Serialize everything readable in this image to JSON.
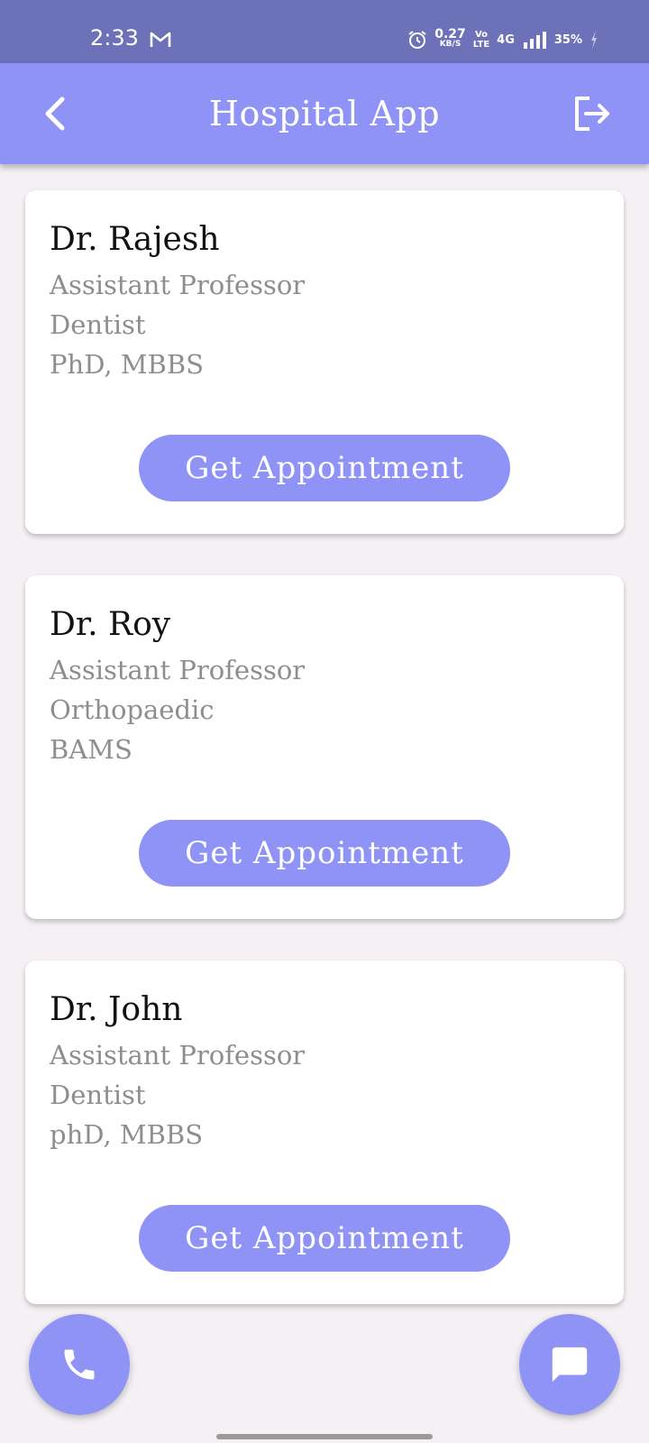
{
  "status_bar": {
    "time": "2:33",
    "net_speed_value": "0.27",
    "net_speed_unit": "KB/S",
    "volte_top": "Vo",
    "volte_bottom": "LTE",
    "network": "4G",
    "battery": "35%",
    "icons": [
      "gmail-icon",
      "alarm-icon",
      "signal-icon",
      "charging-icon"
    ]
  },
  "app_bar": {
    "title": "Hospital App",
    "back_icon": "chevron-left-icon",
    "logout_icon": "logout-icon"
  },
  "doctors": [
    {
      "name": "Dr. Rajesh",
      "title": "Assistant Professor",
      "specialty": "Dentist",
      "degree": "PhD, MBBS",
      "button_label": "Get Appointment"
    },
    {
      "name": "Dr. Roy",
      "title": "Assistant Professor",
      "specialty": "Orthopaedic",
      "degree": "BAMS",
      "button_label": "Get Appointment"
    },
    {
      "name": "Dr. John",
      "title": "Assistant Professor",
      "specialty": "Dentist",
      "degree": "phD, MBBS",
      "button_label": "Get Appointment"
    }
  ],
  "fabs": {
    "left_icon": "phone-icon",
    "right_icon": "chat-icon"
  },
  "colors": {
    "status_bar": "#6c71b8",
    "accent": "#8f93f6",
    "background": "#f4f0f4",
    "card": "#ffffff",
    "secondary_text": "#8e8e8e"
  }
}
